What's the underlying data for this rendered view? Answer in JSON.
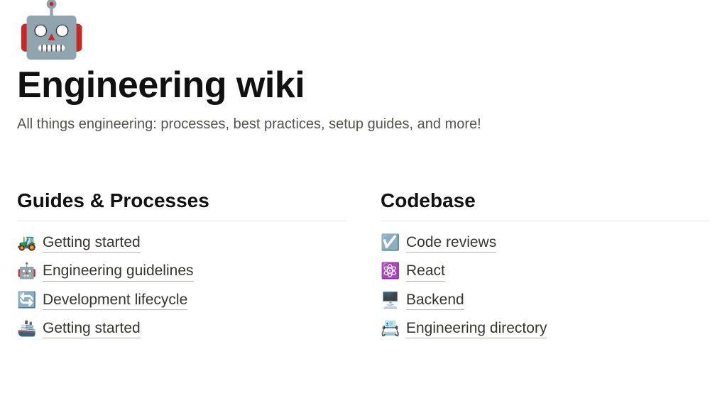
{
  "header": {
    "icon": "🤖",
    "title": "Engineering wiki",
    "subtitle": "All things engineering: processes, best practices, setup guides, and more!"
  },
  "sections": [
    {
      "heading": "Guides & Processes",
      "links": [
        {
          "icon": "🚜",
          "label": "Getting started",
          "name": "link-getting-started"
        },
        {
          "icon": "🤖",
          "label": "Engineering guidelines",
          "name": "link-engineering-guidelines"
        },
        {
          "icon": "🔄",
          "label": "Development lifecycle",
          "name": "link-development-lifecycle"
        },
        {
          "icon": "🚢",
          "label": "Getting started",
          "name": "link-getting-started-2"
        }
      ]
    },
    {
      "heading": "Codebase",
      "links": [
        {
          "icon": "☑️",
          "label": "Code reviews",
          "name": "link-code-reviews"
        },
        {
          "icon": "⚛️",
          "label": "React",
          "name": "link-react"
        },
        {
          "icon": "🖥️",
          "label": "Backend",
          "name": "link-backend"
        },
        {
          "icon": "📇",
          "label": "Engineering directory",
          "name": "link-engineering-directory"
        }
      ]
    }
  ]
}
